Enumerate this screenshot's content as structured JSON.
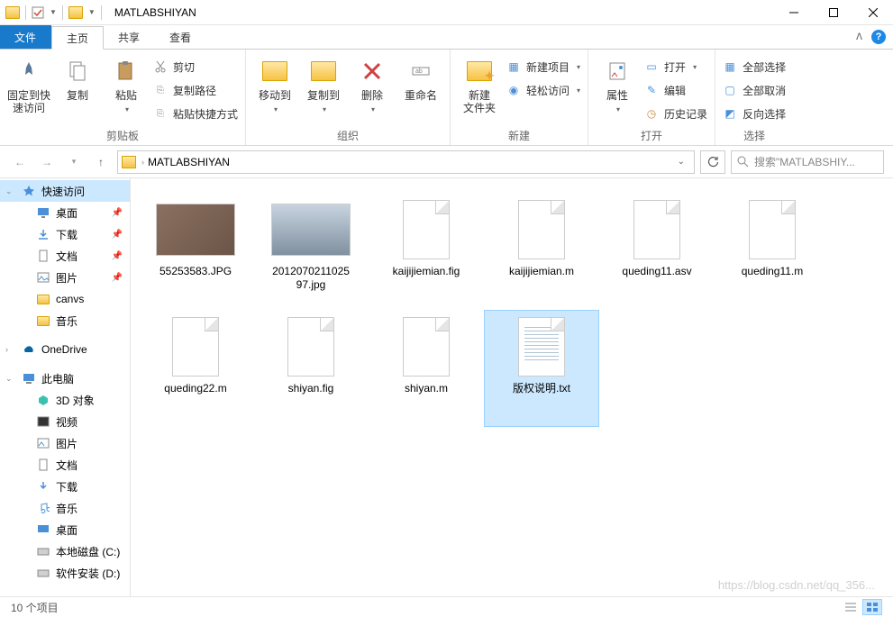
{
  "window": {
    "title": "MATLABSHIYAN"
  },
  "tabs": {
    "file": "文件",
    "home": "主页",
    "share": "共享",
    "view": "查看"
  },
  "ribbon": {
    "pin": "固定到快\n速访问",
    "copy": "复制",
    "paste": "粘贴",
    "cut": "剪切",
    "copypath": "复制路径",
    "pasteshortcut": "粘贴快捷方式",
    "clipboard_label": "剪贴板",
    "moveto": "移动到",
    "copyto": "复制到",
    "delete": "删除",
    "rename": "重命名",
    "organize_label": "组织",
    "newfolder": "新建\n文件夹",
    "newitem": "新建项目",
    "easyaccess": "轻松访问",
    "new_label": "新建",
    "properties": "属性",
    "open": "打开",
    "edit": "编辑",
    "history": "历史记录",
    "open_label": "打开",
    "selectall": "全部选择",
    "selectnone": "全部取消",
    "invertsel": "反向选择",
    "select_label": "选择"
  },
  "address": {
    "folder": "MATLABSHIYAN"
  },
  "search": {
    "placeholder": "搜索\"MATLABSHIY..."
  },
  "sidebar": {
    "quickaccess": "快速访问",
    "desktop": "桌面",
    "downloads": "下载",
    "documents": "文档",
    "pictures": "图片",
    "canvs": "canvs",
    "music": "音乐",
    "onedrive": "OneDrive",
    "thispc": "此电脑",
    "objects3d": "3D 对象",
    "videos": "视频",
    "pictures2": "图片",
    "documents2": "文档",
    "downloads2": "下载",
    "music2": "音乐",
    "desktop2": "桌面",
    "localdisk": "本地磁盘 (C:)",
    "localdisk2": "软件安装 (D:)"
  },
  "files": [
    {
      "name": "55253583.JPG",
      "type": "img1"
    },
    {
      "name": "2012070211025\n97.jpg",
      "type": "img2"
    },
    {
      "name": "kaijijiemian.fig",
      "type": "doc"
    },
    {
      "name": "kaijijiemian.m",
      "type": "doc"
    },
    {
      "name": "queding11.asv",
      "type": "doc"
    },
    {
      "name": "queding11.m",
      "type": "doc"
    },
    {
      "name": "queding22.m",
      "type": "doc"
    },
    {
      "name": "shiyan.fig",
      "type": "doc"
    },
    {
      "name": "shiyan.m",
      "type": "doc"
    },
    {
      "name": "版权说明.txt",
      "type": "txt",
      "selected": true
    }
  ],
  "status": {
    "count": "10 个项目"
  },
  "watermark": "https://blog.csdn.net/qq_356..."
}
